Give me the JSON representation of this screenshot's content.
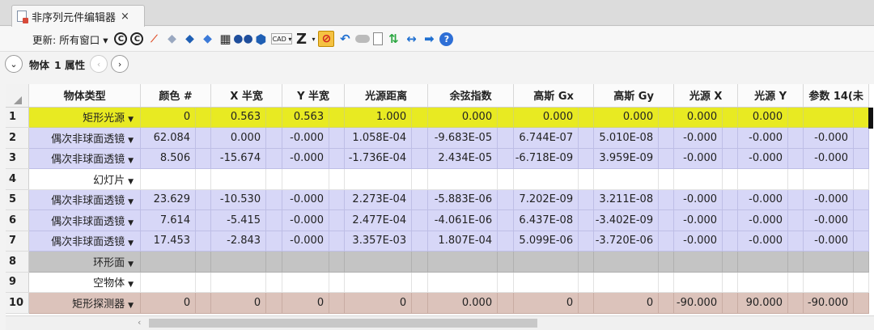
{
  "tab": {
    "title": "非序列元件编辑器",
    "close": "×"
  },
  "toolbar": {
    "update_label": "更新:",
    "update_value": "所有窗口 ▾",
    "cad_label": "CAD ▾",
    "z_label": "Z"
  },
  "objbar": {
    "object_label": "物体",
    "props_label": "1 属性",
    "prev": "‹",
    "next": "›",
    "collapse": "⌄"
  },
  "table": {
    "headers": [
      "物体类型",
      "颜色 #",
      "X 半宽",
      "Y 半宽",
      "光源距离",
      "余弦指数",
      "高斯 Gx",
      "高斯 Gy",
      "光源 X",
      "光源 Y",
      "参数 14(未"
    ],
    "rows": [
      {
        "n": "1",
        "type": "矩形光源",
        "style": "yellow",
        "cells": [
          "0",
          "0.563",
          "0.563",
          "1.000",
          "0.000",
          "0.000",
          "0.000",
          "0.000",
          "0.000",
          ""
        ]
      },
      {
        "n": "2",
        "type": "偶次非球面透镜",
        "style": "lav",
        "cells": [
          "62.084",
          "0.000",
          "-0.000",
          "1.058E-04",
          "-9.683E-05",
          "6.744E-07",
          "5.010E-08",
          "-0.000",
          "-0.000",
          "-0.000"
        ]
      },
      {
        "n": "3",
        "type": "偶次非球面透镜",
        "style": "lav",
        "cells": [
          "8.506",
          "-15.674",
          "-0.000",
          "-1.736E-04",
          "2.434E-05",
          "-6.718E-09",
          "3.959E-09",
          "-0.000",
          "-0.000",
          "-0.000"
        ]
      },
      {
        "n": "4",
        "type": "幻灯片",
        "style": "white",
        "cells": [
          "",
          "",
          "",
          "",
          "",
          "",
          "",
          "",
          "",
          ""
        ]
      },
      {
        "n": "5",
        "type": "偶次非球面透镜",
        "style": "lav",
        "cells": [
          "23.629",
          "-10.530",
          "-0.000",
          "2.273E-04",
          "-5.883E-06",
          "7.202E-09",
          "3.211E-08",
          "-0.000",
          "-0.000",
          "-0.000"
        ]
      },
      {
        "n": "6",
        "type": "偶次非球面透镜",
        "style": "lav",
        "cells": [
          "7.614",
          "-5.415",
          "-0.000",
          "2.477E-04",
          "-4.061E-06",
          "6.437E-08",
          "-3.402E-09",
          "-0.000",
          "-0.000",
          "-0.000"
        ]
      },
      {
        "n": "7",
        "type": "偶次非球面透镜",
        "style": "lav",
        "cells": [
          "17.453",
          "-2.843",
          "-0.000",
          "3.357E-03",
          "1.807E-04",
          "5.099E-06",
          "-3.720E-06",
          "-0.000",
          "-0.000",
          "-0.000"
        ]
      },
      {
        "n": "8",
        "type": "环形面",
        "style": "gray",
        "cells": [
          "",
          "",
          "",
          "",
          "",
          "",
          "",
          "",
          "",
          ""
        ]
      },
      {
        "n": "9",
        "type": "空物体",
        "style": "white",
        "cells": [
          "",
          "",
          "",
          "",
          "",
          "",
          "",
          "",
          "",
          ""
        ]
      },
      {
        "n": "10",
        "type": "矩形探测器",
        "style": "pink",
        "cells": [
          "0",
          "0",
          "0",
          "0",
          "0.000",
          "0",
          "0",
          "-90.000",
          "90.000",
          "-90.000"
        ]
      }
    ]
  },
  "colors": {
    "yellow": "#e8ea22",
    "lavender": "#d7d7f7",
    "gray": "#c4c4c4",
    "pink": "#dcc3bb"
  }
}
